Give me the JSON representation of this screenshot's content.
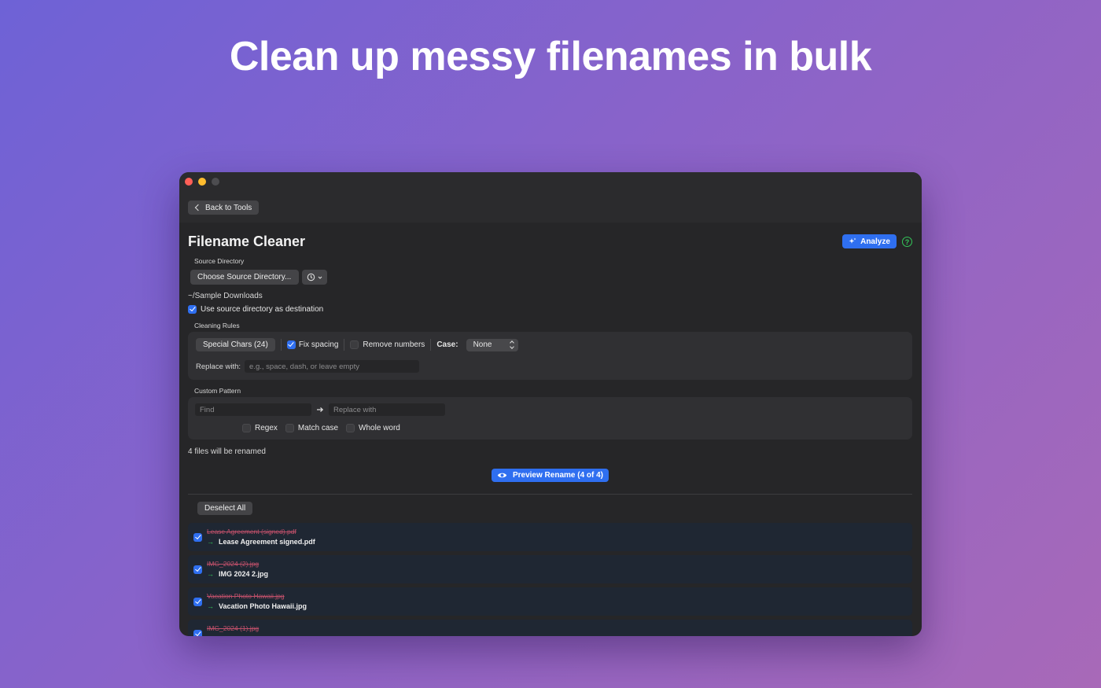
{
  "hero": {
    "headline": "Clean up messy filenames in bulk"
  },
  "toolbar": {
    "back_label": "Back to Tools"
  },
  "header": {
    "title": "Filename Cleaner",
    "analyze_label": "Analyze",
    "help_glyph": "?"
  },
  "source": {
    "section_label": "Source Directory",
    "choose_label": "Choose Source Directory...",
    "path": "~/Sample Downloads",
    "use_as_dest_label": "Use source directory as destination",
    "use_as_dest_checked": true
  },
  "rules": {
    "section_label": "Cleaning Rules",
    "special_chars_label": "Special Chars (24)",
    "fix_spacing_label": "Fix spacing",
    "fix_spacing_checked": true,
    "remove_numbers_label": "Remove numbers",
    "remove_numbers_checked": false,
    "case_label": "Case:",
    "case_value": "None",
    "replace_label": "Replace with:",
    "replace_placeholder": "e.g., space, dash, or leave empty"
  },
  "pattern": {
    "section_label": "Custom Pattern",
    "find_placeholder": "Find",
    "replace_placeholder": "Replace with",
    "regex_label": "Regex",
    "match_case_label": "Match case",
    "whole_word_label": "Whole word"
  },
  "summary": {
    "count_text": "4 files will be renamed"
  },
  "preview": {
    "button_label": "Preview Rename (4 of 4)"
  },
  "results": {
    "deselect_label": "Deselect All",
    "files": [
      {
        "old": "Lease Agreement (signed).pdf",
        "new": "Lease Agreement signed.pdf",
        "checked": true
      },
      {
        "old": "IMG_2024 (2).jpg",
        "new": "IMG 2024 2.jpg",
        "checked": true
      },
      {
        "old": "Vacation Photo  Hawaii.jpg",
        "new": "Vacation Photo Hawaii.jpg",
        "checked": true
      },
      {
        "old": "IMG_2024 (1).jpg",
        "new": "",
        "checked": true
      }
    ]
  },
  "colors": {
    "accent": "#2f6ff0",
    "success": "#34c759",
    "strike": "#c0506a",
    "window_bg": "#262628"
  },
  "icons": [
    "chevron-left-icon",
    "sparkles-icon",
    "help-icon",
    "history-icon",
    "chevron-down-icon",
    "arrow-right-icon",
    "eye-icon",
    "up-down-chevron-icon"
  ]
}
